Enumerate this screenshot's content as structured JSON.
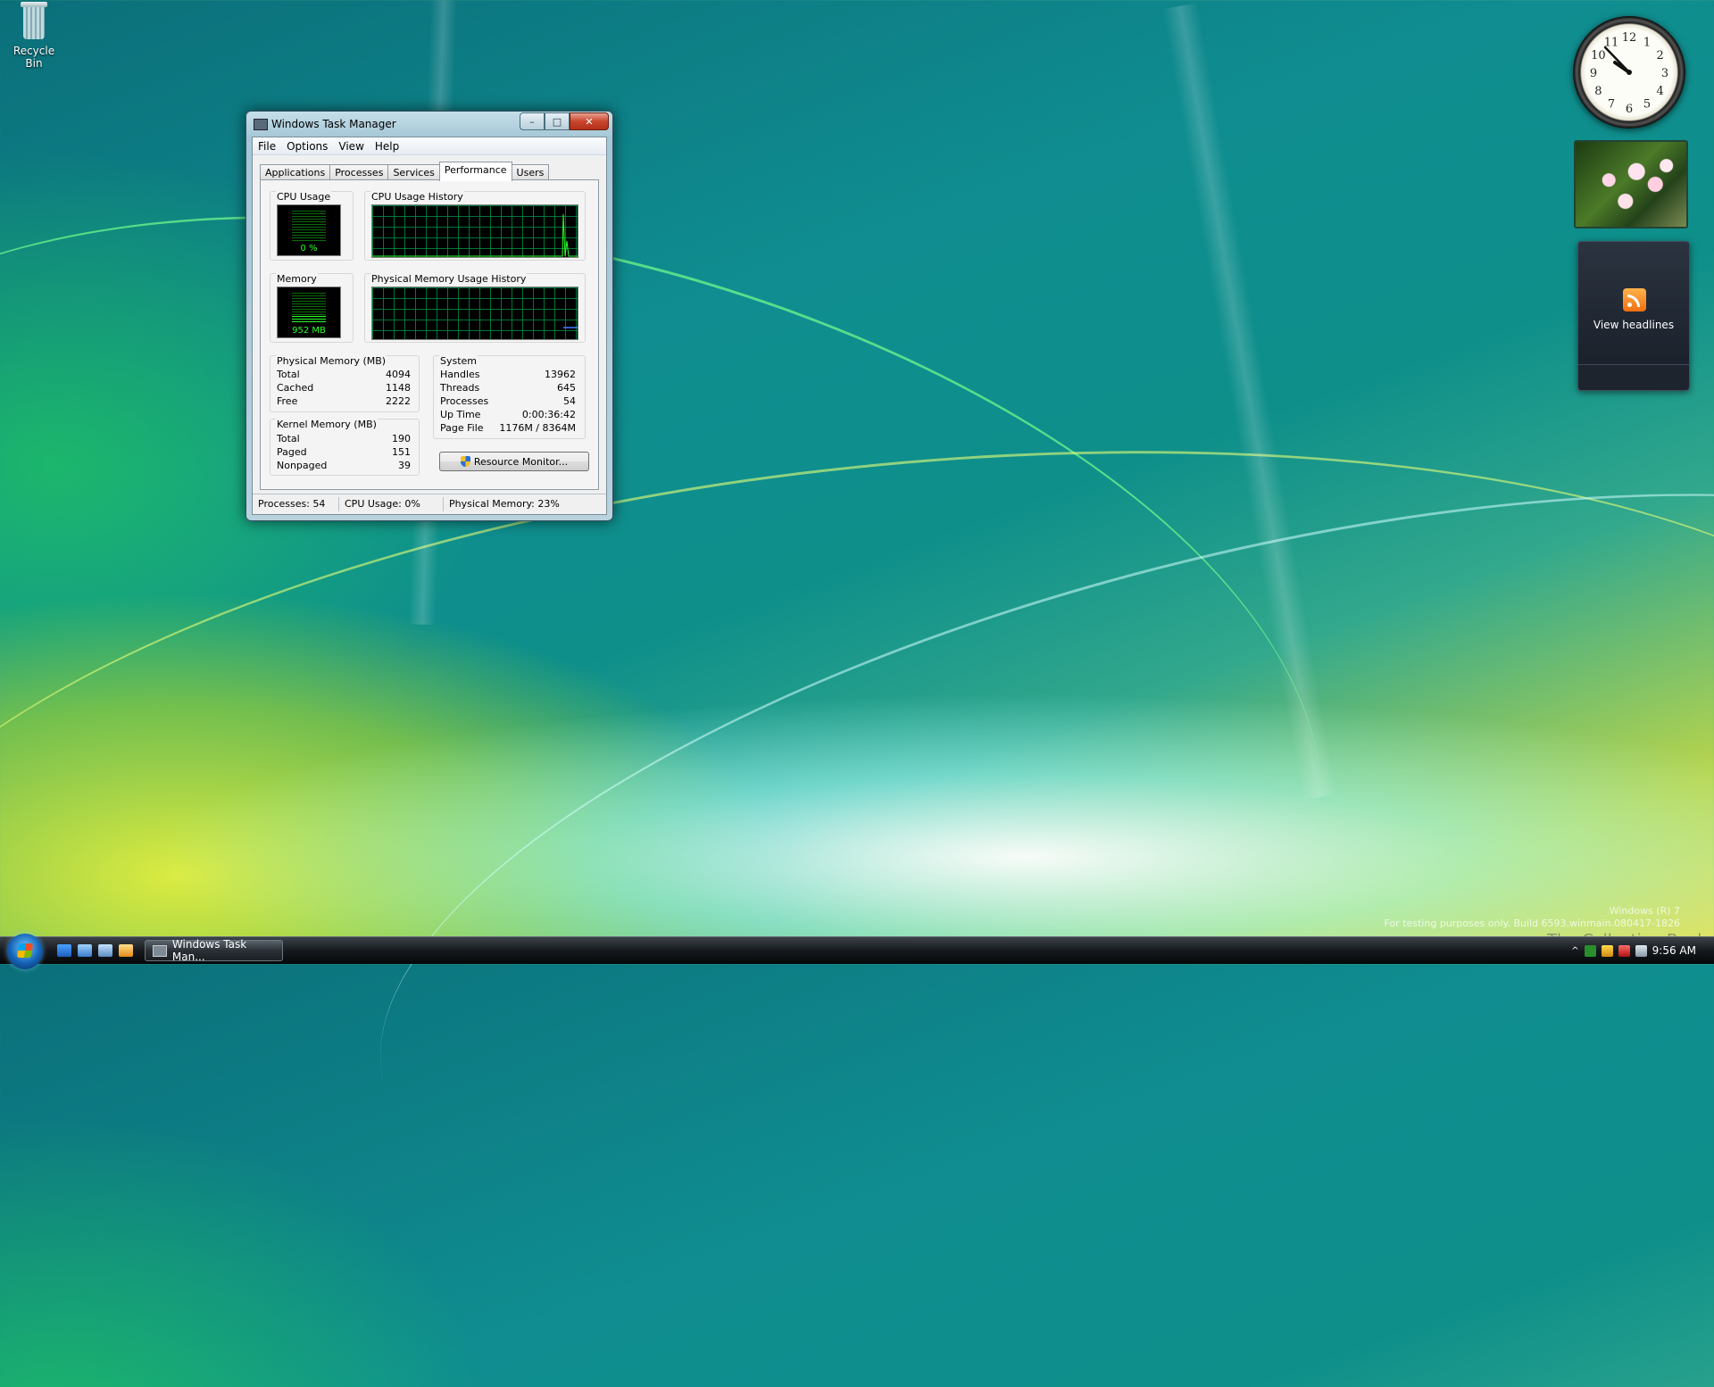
{
  "desktop": {
    "recycle_bin_label": "Recycle Bin"
  },
  "window": {
    "title": "Windows Task Manager",
    "menu": [
      "File",
      "Options",
      "View",
      "Help"
    ],
    "tabs": [
      "Applications",
      "Processes",
      "Services",
      "Performance",
      "Users"
    ],
    "active_tab": "Performance"
  },
  "performance": {
    "cpu_usage_label": "CPU Usage",
    "cpu_usage_value": "0 %",
    "cpu_usage_fraction": 0.0,
    "cpu_history_label": "CPU Usage History",
    "memory_label": "Memory",
    "memory_value": "952 MB",
    "memory_fraction": 0.23,
    "memory_history_label": "Physical Memory Usage History",
    "physical_memory": {
      "header": "Physical Memory (MB)",
      "rows": [
        {
          "label": "Total",
          "value": "4094"
        },
        {
          "label": "Cached",
          "value": "1148"
        },
        {
          "label": "Free",
          "value": "2222"
        }
      ]
    },
    "kernel_memory": {
      "header": "Kernel Memory (MB)",
      "rows": [
        {
          "label": "Total",
          "value": "190"
        },
        {
          "label": "Paged",
          "value": "151"
        },
        {
          "label": "Nonpaged",
          "value": "39"
        }
      ]
    },
    "system": {
      "header": "System",
      "rows": [
        {
          "label": "Handles",
          "value": "13962"
        },
        {
          "label": "Threads",
          "value": "645"
        },
        {
          "label": "Processes",
          "value": "54"
        },
        {
          "label": "Up Time",
          "value": "0:00:36:42"
        },
        {
          "label": "Page File",
          "value": "1176M / 8364M"
        }
      ]
    },
    "resource_monitor_button": "Resource Monitor..."
  },
  "statusbar": {
    "processes": "Processes: 54",
    "cpu": "CPU Usage: 0%",
    "memory": "Physical Memory: 23%"
  },
  "gadgets": {
    "clock_numbers": [
      "12",
      "1",
      "2",
      "3",
      "4",
      "5",
      "6",
      "7",
      "8",
      "9",
      "10",
      "11"
    ],
    "feed_text": "View headlines"
  },
  "watermark": {
    "line1": "Windows (R) 7",
    "line2": "For testing purposes only. Build 6593.winmain.080417-1826",
    "collection": "The Collection Book"
  },
  "taskbar": {
    "task_button": "Windows Task Man...",
    "time": "9:56 AM"
  },
  "colors": {
    "meter_green": "#2bff2b",
    "grid_green": "#008240",
    "history_line_green": "#2bff2b",
    "history_line_blue": "#3c7cff"
  },
  "icons": {
    "recycle_bin": "recycle-bin-icon",
    "start": "windows-orb-icon",
    "rss": "rss-feed-icon",
    "shield": "uac-shield-icon"
  }
}
